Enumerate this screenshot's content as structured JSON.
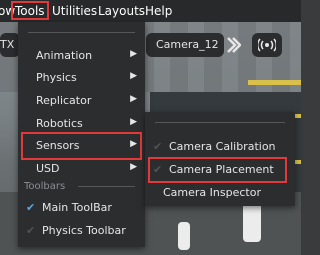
{
  "menubar": {
    "items": [
      "ow",
      "Tools",
      "Utilities",
      "Layouts",
      "Help"
    ]
  },
  "toolbar": {
    "left_fragment": "TX",
    "camera_label": "Camera_12"
  },
  "tools_menu": {
    "items": [
      {
        "label": "Animation",
        "has_submenu": true
      },
      {
        "label": "Physics",
        "has_submenu": true
      },
      {
        "label": "Replicator",
        "has_submenu": true
      },
      {
        "label": "Robotics",
        "has_submenu": true
      },
      {
        "label": "Sensors",
        "has_submenu": true
      },
      {
        "label": "USD",
        "has_submenu": true
      }
    ],
    "section_title": "Toolbars",
    "toolbars": [
      {
        "label": "Main ToolBar",
        "checked": true
      },
      {
        "label": "Physics Toolbar",
        "checked": false
      }
    ]
  },
  "sensors_submenu": {
    "items": [
      {
        "label": "Camera Calibration",
        "checked": false
      },
      {
        "label": "Camera Placement",
        "checked": false
      },
      {
        "label": "Camera Inspector",
        "checked": false
      }
    ]
  },
  "colors": {
    "highlight_border": "#e23a3a",
    "menu_bg": "#2b2d2f",
    "check_active": "#5aa7e0"
  }
}
